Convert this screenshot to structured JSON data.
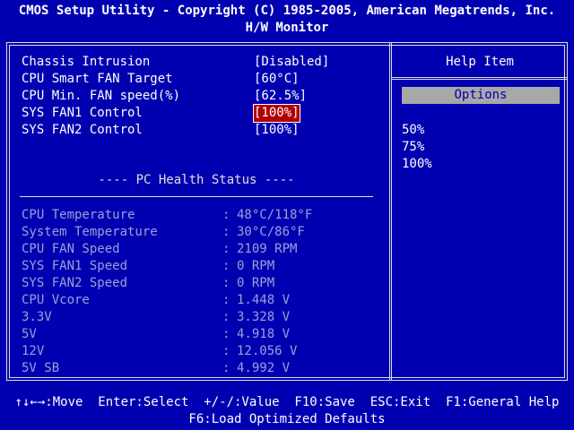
{
  "header": {
    "title": "CMOS Setup Utility - Copyright (C) 1985-2005, American Megatrends, Inc.",
    "subtitle": "H/W Monitor"
  },
  "settings": [
    {
      "label": "Chassis Intrusion",
      "value": "[Disabled]",
      "selected": false
    },
    {
      "label": "CPU Smart FAN Target",
      "value": "[60°C]",
      "selected": false
    },
    {
      "label": "CPU Min. FAN speed(%)",
      "value": "[62.5%]",
      "selected": false
    },
    {
      "label": "SYS FAN1 Control",
      "value": "[100%]",
      "selected": true
    },
    {
      "label": "SYS FAN2 Control",
      "value": "[100%]",
      "selected": false
    }
  ],
  "health": {
    "title": "---- PC Health Status ----",
    "colon": ":",
    "items": [
      {
        "label": "CPU Temperature",
        "value": "48°C/118°F"
      },
      {
        "label": "System Temperature",
        "value": "30°C/86°F"
      },
      {
        "label": "CPU FAN Speed",
        "value": "2109 RPM"
      },
      {
        "label": "SYS FAN1 Speed",
        "value": "0 RPM"
      },
      {
        "label": "SYS FAN2 Speed",
        "value": "0 RPM"
      },
      {
        "label": "CPU Vcore",
        "value": "1.448 V"
      },
      {
        "label": "3.3V",
        "value": "3.328 V"
      },
      {
        "label": "5V",
        "value": "4.918 V"
      },
      {
        "label": "12V",
        "value": "12.056 V"
      },
      {
        "label": "5V SB",
        "value": "4.992 V"
      }
    ]
  },
  "help": {
    "title": "Help Item",
    "options_label": "Options",
    "options": [
      "50%",
      "75%",
      "100%"
    ]
  },
  "footer": {
    "line1": "↑↓←→:Move  Enter:Select  +/-/:Value  F10:Save  ESC:Exit  F1:General Help",
    "line2": "F6:Load Optimized Defaults"
  },
  "colors": {
    "background": "#0000b0",
    "selected": "#b00000",
    "disabled_text": "#9ca0d8",
    "options_bar": "#a8a8a8"
  }
}
